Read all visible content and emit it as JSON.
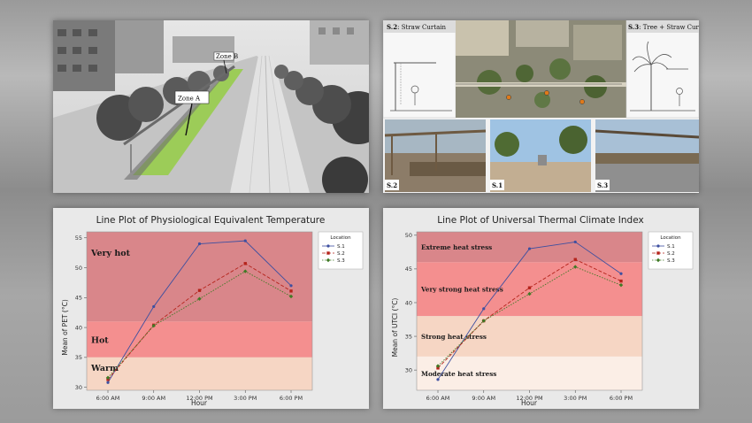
{
  "photos": {
    "zone_label": "Zone A",
    "zone_b_label": "Zone B",
    "s2_caption_bold": "S.2",
    "s2_caption": ": Straw Curtain",
    "s3_caption_bold": "S.3",
    "s3_caption": ": Tree + Straw Curtain",
    "tags": [
      "S.2",
      "S.1",
      "S.3"
    ]
  },
  "colors": {
    "s1": "#3d4fa0",
    "s2": "#b5231b",
    "s3": "#3f7a25",
    "zone_very_hot": "#d9868a",
    "zone_hot": "#f48f8f",
    "zone_warm": "#f6d6c4"
  },
  "chart_data": [
    {
      "type": "line",
      "title": "Line Plot of Physiological Equivalent Temperature",
      "xlabel": "Hour",
      "ylabel": "Mean of PET (°C)",
      "categories": [
        "6:00 AM",
        "9:00 AM",
        "12:00 PM",
        "3:00 PM",
        "6:00 PM"
      ],
      "ylim": [
        29.5,
        56
      ],
      "yticks": [
        30,
        35,
        40,
        45,
        50,
        55
      ],
      "legend_title": "Location",
      "legend_position": "top-right",
      "series": [
        {
          "name": "S.1",
          "values": [
            30.8,
            43.5,
            54,
            54.5,
            47
          ]
        },
        {
          "name": "S.2",
          "values": [
            31.3,
            40.4,
            46.2,
            50.7,
            46.1
          ]
        },
        {
          "name": "S.3",
          "values": [
            31.6,
            40.3,
            44.8,
            49.4,
            45.2
          ]
        }
      ],
      "zones": [
        {
          "label": "Very hot",
          "from": 41,
          "to": 56
        },
        {
          "label": "Hot",
          "from": 35,
          "to": 41
        },
        {
          "label": "Warm",
          "from": 29.5,
          "to": 35
        }
      ]
    },
    {
      "type": "line",
      "title": "Line Plot of Universal Thermal Climate Index",
      "xlabel": "Hour",
      "ylabel": "Mean of UTCI (°C)",
      "categories": [
        "6:00 AM",
        "9:00 AM",
        "12:00 PM",
        "3:00 PM",
        "6:00 PM"
      ],
      "ylim": [
        27,
        50.5
      ],
      "yticks": [
        30,
        35,
        40,
        45,
        50
      ],
      "legend_title": "Location",
      "legend_position": "top-right",
      "series": [
        {
          "name": "S.1",
          "values": [
            28.6,
            39.1,
            48,
            49,
            44.3
          ]
        },
        {
          "name": "S.2",
          "values": [
            30.3,
            37.3,
            42.2,
            46.4,
            43.2
          ]
        },
        {
          "name": "S.3",
          "values": [
            30.6,
            37.3,
            41.3,
            45.3,
            42.6
          ]
        }
      ],
      "zones": [
        {
          "label": "Extreme heat stress",
          "from": 46,
          "to": 50.5
        },
        {
          "label": "Very strong heat stress",
          "from": 38,
          "to": 46
        },
        {
          "label": "Strong heat stress",
          "from": 32,
          "to": 38
        },
        {
          "label": "Moderate heat stress",
          "from": 27,
          "to": 32
        }
      ]
    }
  ]
}
